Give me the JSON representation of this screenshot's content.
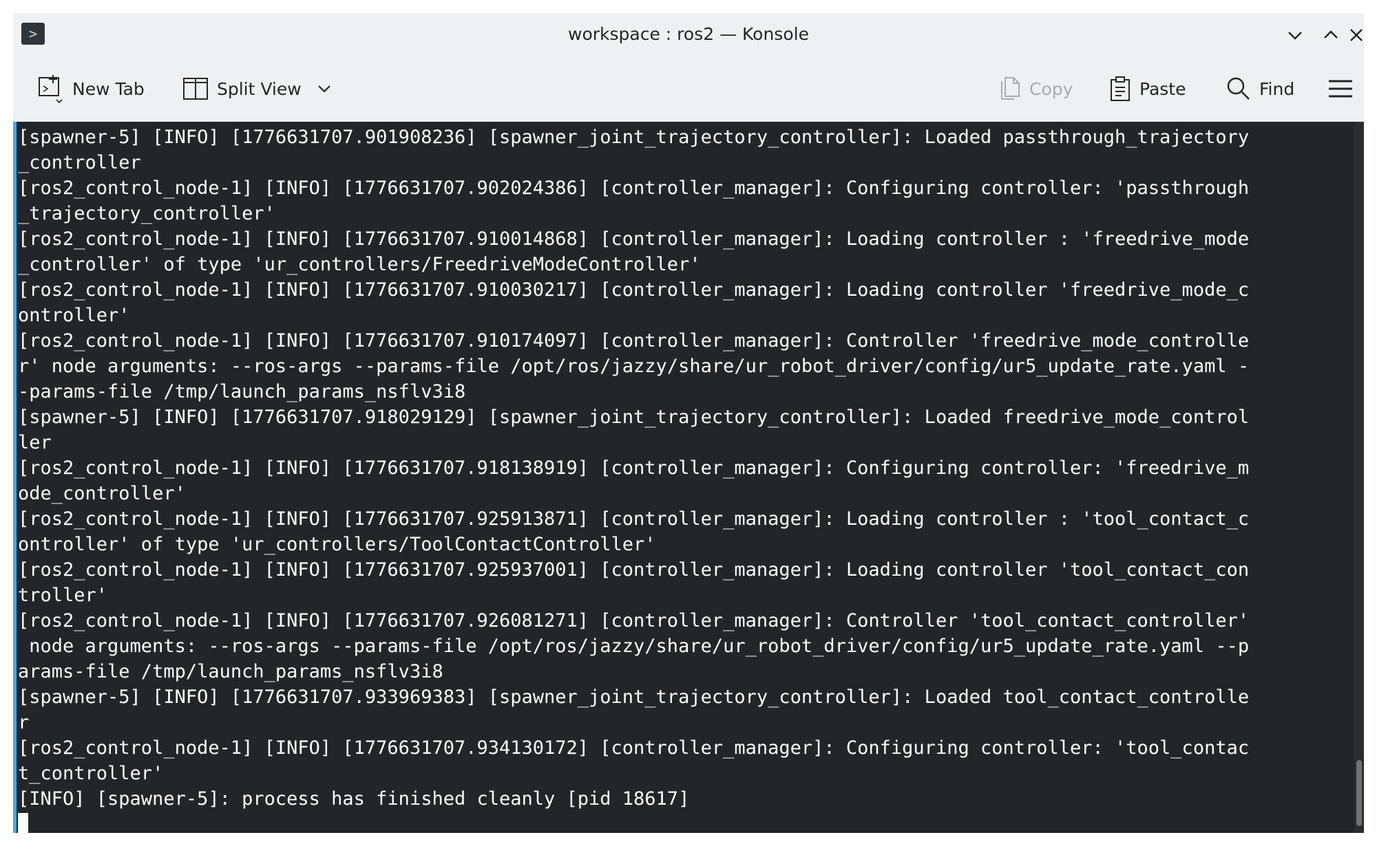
{
  "window": {
    "title": "workspace : ros2 — Konsole",
    "app_icon_glyph": ">",
    "controls": [
      "minimize",
      "maximize",
      "close"
    ]
  },
  "toolbar": {
    "new_tab_label": "New Tab",
    "split_view_label": "Split View",
    "copy_label": "Copy",
    "paste_label": "Paste",
    "find_label": "Find"
  },
  "icons": {
    "new_tab": "new-tab-icon",
    "split_view": "split-view-icon",
    "dropdown": "chevron-down-icon",
    "copy": "copy-icon",
    "paste": "paste-icon",
    "find": "search-icon",
    "menu": "hamburger-menu-icon"
  },
  "colors": {
    "terminal_bg": "#232629",
    "terminal_fg": "#fcfcfc",
    "focus_accent": "#3daee9",
    "chrome_bg": "#eff0f1"
  },
  "terminal": {
    "lines": [
      "[spawner-5] [INFO] [1776631707.901908236] [spawner_joint_trajectory_controller]: Loaded passthrough_trajectory",
      "_controller",
      "[ros2_control_node-1] [INFO] [1776631707.902024386] [controller_manager]: Configuring controller: 'passthrough",
      "_trajectory_controller'",
      "[ros2_control_node-1] [INFO] [1776631707.910014868] [controller_manager]: Loading controller : 'freedrive_mode",
      "_controller' of type 'ur_controllers/FreedriveModeController'",
      "[ros2_control_node-1] [INFO] [1776631707.910030217] [controller_manager]: Loading controller 'freedrive_mode_c",
      "ontroller'",
      "[ros2_control_node-1] [INFO] [1776631707.910174097] [controller_manager]: Controller 'freedrive_mode_controlle",
      "r' node arguments: --ros-args --params-file /opt/ros/jazzy/share/ur_robot_driver/config/ur5_update_rate.yaml -",
      "-params-file /tmp/launch_params_nsflv3i8",
      "[spawner-5] [INFO] [1776631707.918029129] [spawner_joint_trajectory_controller]: Loaded freedrive_mode_control",
      "ler",
      "[ros2_control_node-1] [INFO] [1776631707.918138919] [controller_manager]: Configuring controller: 'freedrive_m",
      "ode_controller'",
      "[ros2_control_node-1] [INFO] [1776631707.925913871] [controller_manager]: Loading controller : 'tool_contact_c",
      "ontroller' of type 'ur_controllers/ToolContactController'",
      "[ros2_control_node-1] [INFO] [1776631707.925937001] [controller_manager]: Loading controller 'tool_contact_con",
      "troller'",
      "[ros2_control_node-1] [INFO] [1776631707.926081271] [controller_manager]: Controller 'tool_contact_controller'",
      " node arguments: --ros-args --params-file /opt/ros/jazzy/share/ur_robot_driver/config/ur5_update_rate.yaml --p",
      "arams-file /tmp/launch_params_nsflv3i8",
      "[spawner-5] [INFO] [1776631707.933969383] [spawner_joint_trajectory_controller]: Loaded tool_contact_controlle",
      "r",
      "[ros2_control_node-1] [INFO] [1776631707.934130172] [controller_manager]: Configuring controller: 'tool_contac",
      "t_controller'",
      "[INFO] [spawner-5]: process has finished cleanly [pid 18617]"
    ]
  }
}
